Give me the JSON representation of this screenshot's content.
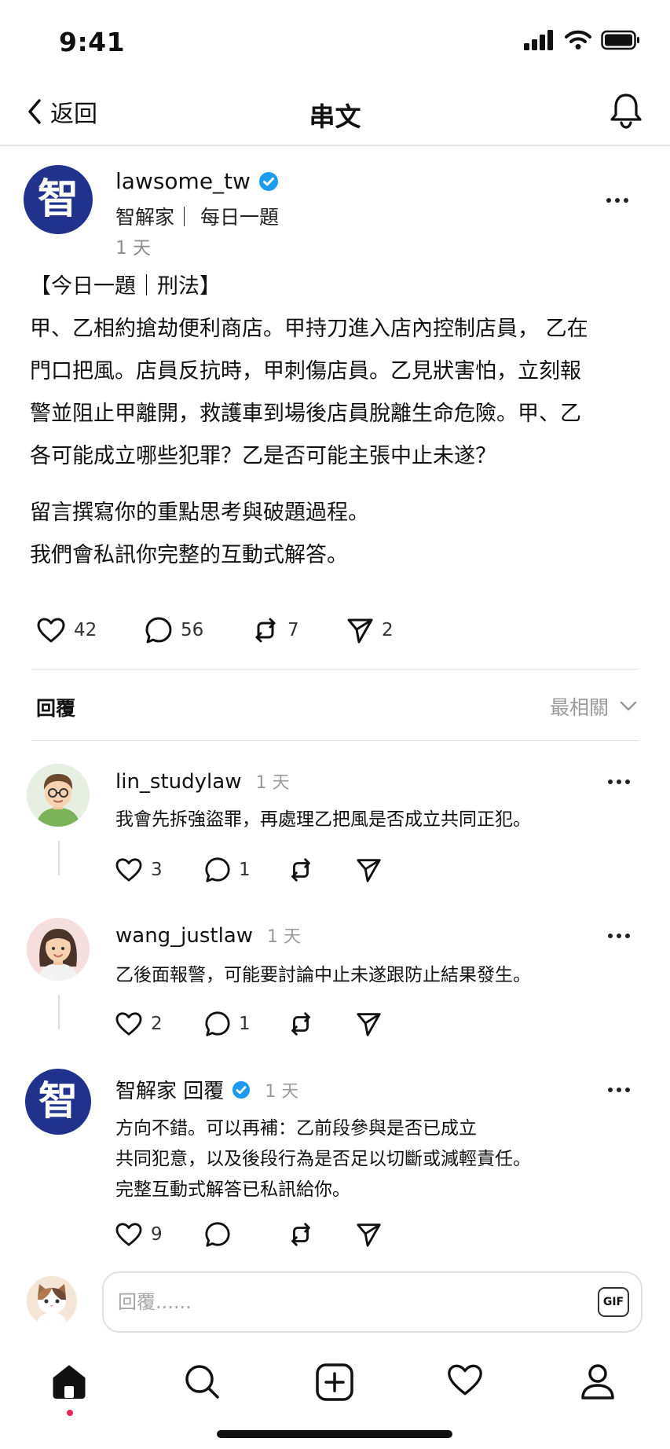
{
  "status": {
    "time": "9:41"
  },
  "nav": {
    "back_label": "返回",
    "title": "串文"
  },
  "post": {
    "author": "lawsome_tw",
    "avatar_glyph": "智",
    "subtitle": "智解家｜ 每日一題",
    "time": "1 天",
    "lines": [
      "【今日一題｜刑法】",
      "甲、乙相約搶劫便利商店。甲持刀進入店內控制店員， 乙在",
      "門口把風。店員反抗時，甲刺傷店員。乙見狀害怕，立刻報",
      "警並阻止甲離開，救護車到場後店員脫離生命危險。甲、乙",
      "各可能成立哪些犯罪？乙是否可能主張中止未遂？",
      "留言撰寫你的重點思考與破題過程。",
      "我們會私訊你完整的互動式解答。"
    ],
    "likes": "42",
    "comments": "56",
    "reposts": "7",
    "shares": "2"
  },
  "replies_header": {
    "label": "回覆",
    "sort_label": "最相關"
  },
  "comments": [
    {
      "name": "lin_studylaw",
      "time": "1 天",
      "text": "我會先拆強盜罪，再處理乙把風是否成立共同正犯。",
      "likes": "3",
      "comments": "1"
    },
    {
      "name": "wang_justlaw",
      "time": "1 天",
      "text": "乙後面報警，可能要討論中止未遂跟防止結果發生。",
      "likes": "2",
      "comments": "1"
    },
    {
      "name": "智解家 回覆",
      "avatar_glyph": "智",
      "time": "1 天",
      "lines": [
        "方向不錯。可以再補：乙前段參與是否已成立",
        "共同犯意，以及後段行為是否足以切斷或減輕責任。",
        "完整互動式解答已私訊給你。"
      ],
      "likes": "9"
    }
  ],
  "reply_bar": {
    "placeholder": "回覆......",
    "gif_label": "GIF"
  },
  "colors": {
    "brand": "#20328c",
    "verified": "#1d9bf0",
    "notification_dot": "#e8265c"
  }
}
